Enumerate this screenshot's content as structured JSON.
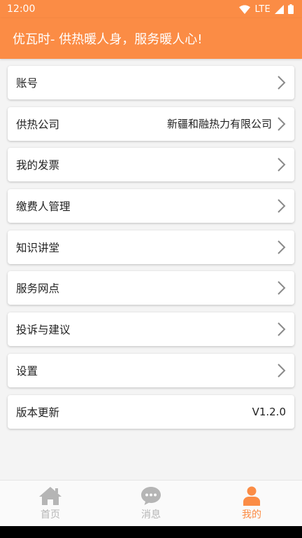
{
  "status_bar": {
    "time": "12:00",
    "network": "LTE"
  },
  "header": {
    "title": "优瓦时- 供热暖人身，服务暖人心!"
  },
  "menu": [
    {
      "label": "账号",
      "value": ""
    },
    {
      "label": "供热公司",
      "value": "新疆和融热力有限公司"
    },
    {
      "label": "我的发票",
      "value": ""
    },
    {
      "label": "缴费人管理",
      "value": ""
    },
    {
      "label": "知识讲堂",
      "value": ""
    },
    {
      "label": "服务网点",
      "value": ""
    },
    {
      "label": "投诉与建议",
      "value": ""
    },
    {
      "label": "设置",
      "value": ""
    },
    {
      "label": "版本更新",
      "value": "V1.2.0"
    }
  ],
  "tabs": [
    {
      "label": "首页",
      "icon": "home-icon",
      "active": false
    },
    {
      "label": "消息",
      "icon": "message-icon",
      "active": false
    },
    {
      "label": "我的",
      "icon": "person-icon",
      "active": true
    }
  ],
  "colors": {
    "accent": "#fb8c45",
    "inactive": "#b5b5b5",
    "background": "#f4f4f4"
  }
}
